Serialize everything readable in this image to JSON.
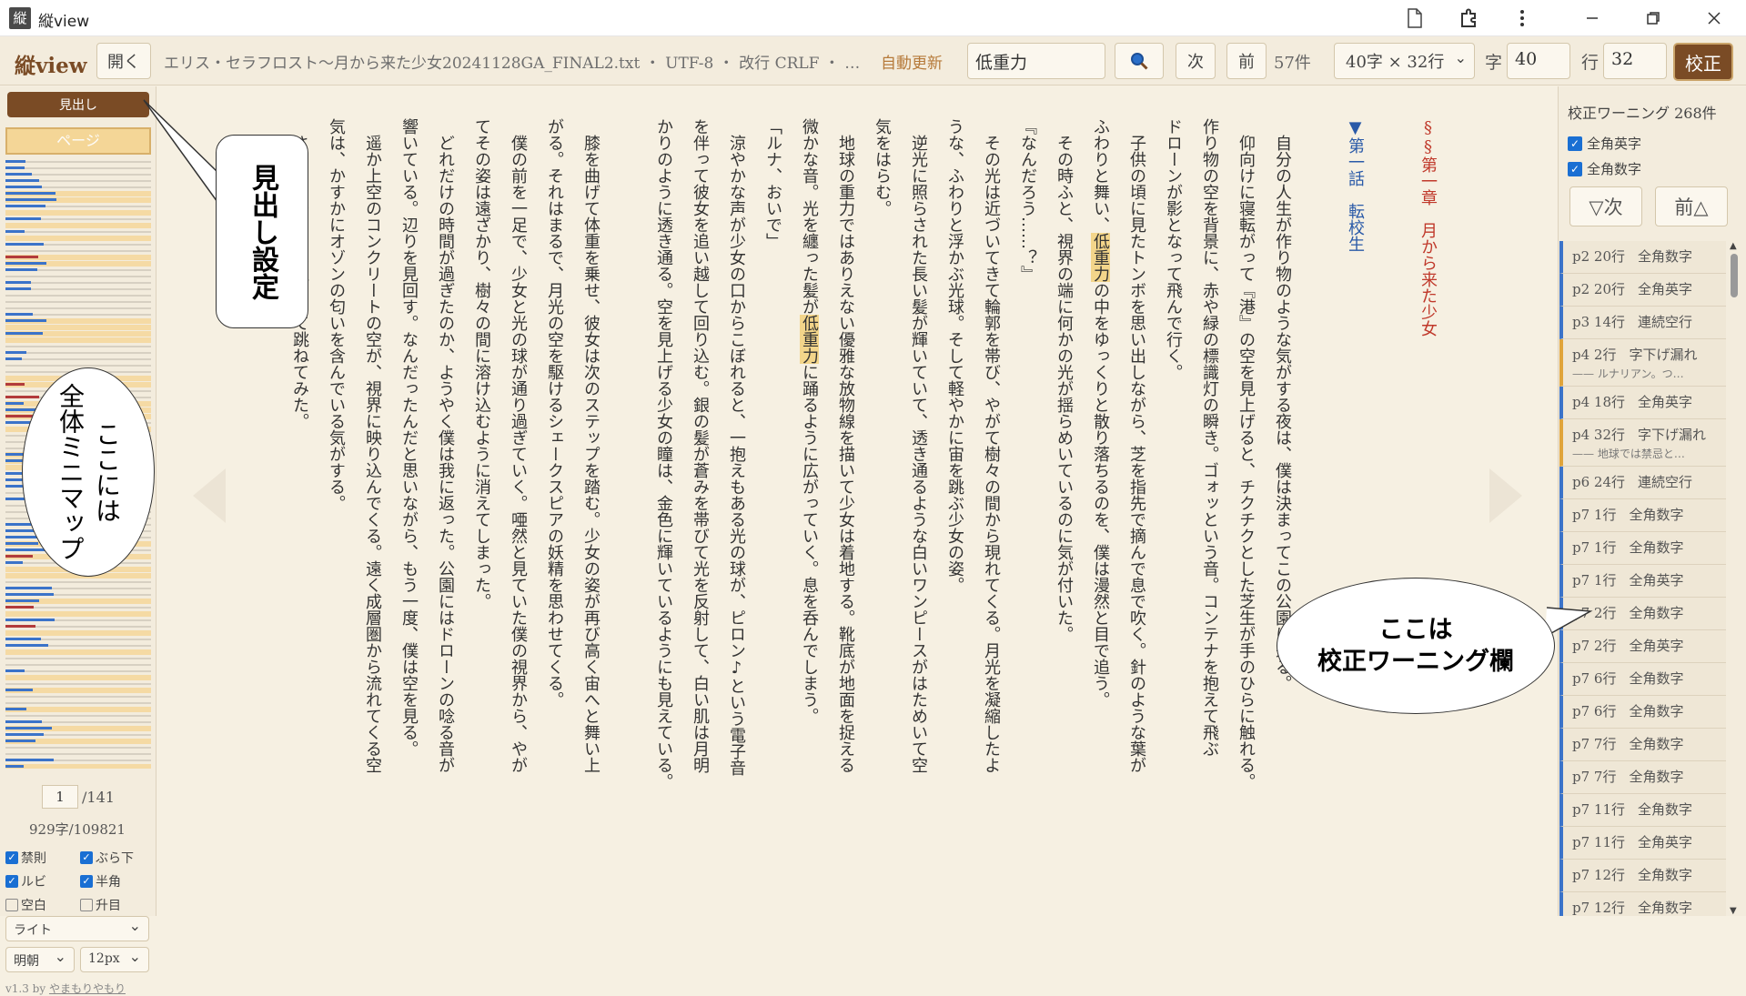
{
  "window": {
    "icon": "縦",
    "title": "縦view",
    "icons": [
      "document-icon",
      "extension-icon",
      "more-vert-icon",
      "minimize-icon",
      "restore-icon",
      "close-icon"
    ]
  },
  "toolbar": {
    "logo": "縦view",
    "open": "開く",
    "filename": "エリス・セラフロスト～月から来た少女20241128GA_FINAL2.txt ・ UTF-8 ・ 改行 CRLF ・ …",
    "auto_update": "自動更新",
    "search_value": "低重力",
    "next": "次",
    "prev": "前",
    "count": "57件",
    "layout": "40字 × 32行",
    "char_label": "字",
    "char_value": "40",
    "line_label": "行",
    "line_value": "32",
    "kousei": "校正"
  },
  "left": {
    "midashi": "見出し",
    "page_indicator": "ページ",
    "page_value": "1",
    "page_total": "/141",
    "chars": "929字/109821",
    "checks": [
      {
        "label": "禁則",
        "on": true
      },
      {
        "label": "ぶら下",
        "on": true
      },
      {
        "label": "ルビ",
        "on": true
      },
      {
        "label": "半角",
        "on": true
      },
      {
        "label": "空白",
        "on": false
      },
      {
        "label": "升目",
        "on": false
      }
    ],
    "theme": "ライト",
    "font": "明朝",
    "size": "12px",
    "version": "v1.3 by",
    "author": "やまもりやもり"
  },
  "main": {
    "columns": [
      "§§第一章　月から来た少女",
      "",
      "▼第一話　転校生",
      "",
      "　自分の人生が作り物のような気がする夜は、僕は決まってこの公園に来る。",
      "　仰向けに寝転がって『港』の空を見上げると、チクチクとした芝生が手のひらに触れる。",
      "作り物の空を背景に、赤や緑の標識灯の瞬き。ゴォッという音。コンテナを抱えて飛ぶ",
      "ドローンが影となって飛んで行く。",
      "　子供の頃に見たトンボを思い出しながら、芝を指先で摘んで息で吹く。針のような葉が",
      "ふわりと舞い、低重力の中をゆっくりと散り落ちるのを、僕は漫然と目で追う。",
      "　その時ふと、視界の端に何かの光が揺らめいているのに気が付いた。",
      "『なんだろう……？』",
      "　その光は近づいてきて輪郭を帯び、やがて樹々の間から現れてくる。月光を凝縮したよ",
      "うな、ふわりと浮かぶ光球。そして軽やかに宙を跳ぶ少女の姿。",
      "　逆光に照らされた長い髪が輝いていて、透き通るような白いワンピースがはためいて空",
      "気をはらむ。",
      "　地球の重力ではありえない優雅な放物線を描いて少女は着地する。靴底が地面を捉える",
      "微かな音。光を纏った髪が低重力に踊るように広がっていく。息を呑んでしまう。",
      "「ルナ、おいで」",
      "　涼やかな声が少女の口からこぼれると、一抱えもある光の球が、ピロン♪という電子音",
      "を伴って彼女を追い越して回り込む。銀の髪が蒼みを帯びて光を反射して、白い肌は月明",
      "かりのように透き通る。空を見上げる少女の瞳は、金色に輝いているようにも見えている。",
      "",
      "　膝を曲げて体重を乗せ、彼女は次のステップを踏む。少女の姿が再び高く宙へと舞い上",
      "がる。それはまるで、月光の空を駆けるシェークスピアの妖精を思わせてくる。",
      "　僕の前を一足で、少女と光の球が通り過ぎていく。唖然と見ていた僕の視界から、やが",
      "てその姿は遠ざかり、樹々の間に溶け込むように消えてしまった。",
      "　どれだけの時間が過ぎたのか、ようやく僕は我に返った。公園にはドローンの唸る音が",
      "響いている。辺りを見回す。なんだったんだと思いながら、もう一度、僕は空を見る。",
      "　遥か上空のコンクリートの空が、視界に映り込んでくる。遠く成層圏から流れてくる空",
      "気は、かすかにオゾンの匂いを含んでいる気がする。",
      "　さっきの少女の真似をして跳ねてみた。"
    ]
  },
  "right": {
    "title": "校正ワーニング 268件",
    "check1": "全角英字",
    "check2": "全角数字",
    "next": "▽次",
    "prev": "前△",
    "warnings": [
      {
        "loc": "p2 20行",
        "kind": "全角数字",
        "type": "b"
      },
      {
        "loc": "p2 20行",
        "kind": "全角英字",
        "type": "b"
      },
      {
        "loc": "p3 14行",
        "kind": "連続空行",
        "type": "b"
      },
      {
        "loc": "p4 2行",
        "kind": "字下げ漏れ",
        "sub": "—— ルナリアン。つ…",
        "type": "o"
      },
      {
        "loc": "p4 18行",
        "kind": "全角英字",
        "type": "b"
      },
      {
        "loc": "p4 32行",
        "kind": "字下げ漏れ",
        "sub": "—— 地球では禁忌と…",
        "type": "o"
      },
      {
        "loc": "p6 24行",
        "kind": "連続空行",
        "type": "b"
      },
      {
        "loc": "p7 1行",
        "kind": "全角数字",
        "type": "b"
      },
      {
        "loc": "p7 1行",
        "kind": "全角数字",
        "type": "b"
      },
      {
        "loc": "p7 1行",
        "kind": "全角英字",
        "type": "b"
      },
      {
        "loc": "p7 2行",
        "kind": "全角数字",
        "type": "b"
      },
      {
        "loc": "p7 2行",
        "kind": "全角英字",
        "type": "b"
      },
      {
        "loc": "p7 6行",
        "kind": "全角数字",
        "type": "b"
      },
      {
        "loc": "p7 6行",
        "kind": "全角数字",
        "type": "b"
      },
      {
        "loc": "p7 7行",
        "kind": "全角数字",
        "type": "b"
      },
      {
        "loc": "p7 7行",
        "kind": "全角数字",
        "type": "b"
      },
      {
        "loc": "p7 11行",
        "kind": "全角数字",
        "type": "b"
      },
      {
        "loc": "p7 11行",
        "kind": "全角英字",
        "type": "b"
      },
      {
        "loc": "p7 12行",
        "kind": "全角数字",
        "type": "b"
      },
      {
        "loc": "p7 12行",
        "kind": "全角数字",
        "type": "b"
      }
    ]
  },
  "annotations": {
    "midashi": "見出し設定",
    "minimap": "ここには\n全体ミニマップ",
    "warning": "ここは\n校正ワーニング欄"
  },
  "colors": {
    "accent": "#7a4b25",
    "highlight": "#f3d58a",
    "heading_red": "#c0392b",
    "heading_blue": "#2a5aa8",
    "minimap_blue": "#3b73c9",
    "minimap_yellow": "#f5d38b",
    "minimap_red": "#b23b3b"
  }
}
